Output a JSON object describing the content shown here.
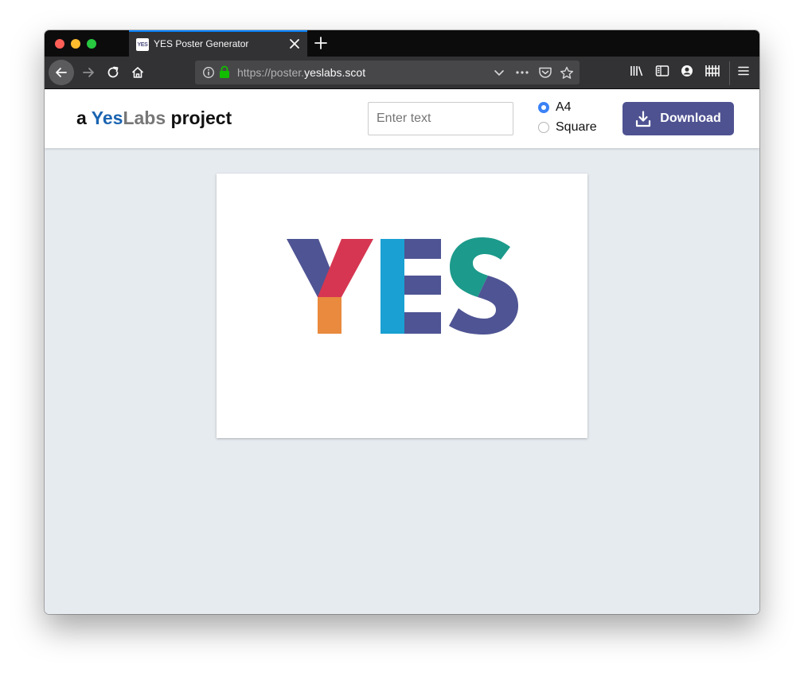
{
  "browser": {
    "tab": {
      "favicon_text": "YES",
      "title": "YES Poster Generator",
      "close_icon": "close-icon"
    },
    "new_tab_icon": "plus-icon",
    "url": {
      "scheme_prefix": "https://poster.",
      "host": "yeslabs.scot"
    },
    "accent": "#0a84ff"
  },
  "page": {
    "brand": {
      "prefix": "a ",
      "yes": "Yes",
      "labs": "Labs",
      "suffix": " project"
    },
    "text_input": {
      "placeholder": "Enter text",
      "value": ""
    },
    "format_options": [
      {
        "label": "A4",
        "selected": true
      },
      {
        "label": "Square",
        "selected": false
      }
    ],
    "download_button": {
      "label": "Download",
      "icon": "download-icon",
      "color": "#4e5291"
    },
    "poster": {
      "logo_letters": "YES",
      "colors": {
        "purple": "#4f5494",
        "red": "#d63651",
        "orange": "#e98a3f",
        "blue": "#1aa0d2",
        "teal": "#1c9a8b"
      }
    }
  }
}
